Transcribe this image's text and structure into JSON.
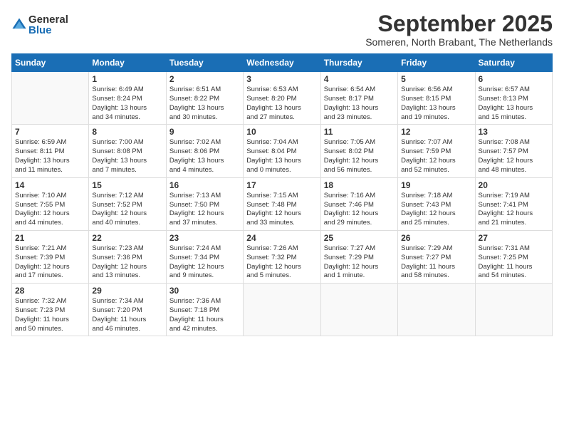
{
  "logo": {
    "general": "General",
    "blue": "Blue"
  },
  "title": "September 2025",
  "location": "Someren, North Brabant, The Netherlands",
  "weekdays": [
    "Sunday",
    "Monday",
    "Tuesday",
    "Wednesday",
    "Thursday",
    "Friday",
    "Saturday"
  ],
  "weeks": [
    [
      {
        "day": "",
        "content": ""
      },
      {
        "day": "1",
        "content": "Sunrise: 6:49 AM\nSunset: 8:24 PM\nDaylight: 13 hours\nand 34 minutes."
      },
      {
        "day": "2",
        "content": "Sunrise: 6:51 AM\nSunset: 8:22 PM\nDaylight: 13 hours\nand 30 minutes."
      },
      {
        "day": "3",
        "content": "Sunrise: 6:53 AM\nSunset: 8:20 PM\nDaylight: 13 hours\nand 27 minutes."
      },
      {
        "day": "4",
        "content": "Sunrise: 6:54 AM\nSunset: 8:17 PM\nDaylight: 13 hours\nand 23 minutes."
      },
      {
        "day": "5",
        "content": "Sunrise: 6:56 AM\nSunset: 8:15 PM\nDaylight: 13 hours\nand 19 minutes."
      },
      {
        "day": "6",
        "content": "Sunrise: 6:57 AM\nSunset: 8:13 PM\nDaylight: 13 hours\nand 15 minutes."
      }
    ],
    [
      {
        "day": "7",
        "content": "Sunrise: 6:59 AM\nSunset: 8:11 PM\nDaylight: 13 hours\nand 11 minutes."
      },
      {
        "day": "8",
        "content": "Sunrise: 7:00 AM\nSunset: 8:08 PM\nDaylight: 13 hours\nand 7 minutes."
      },
      {
        "day": "9",
        "content": "Sunrise: 7:02 AM\nSunset: 8:06 PM\nDaylight: 13 hours\nand 4 minutes."
      },
      {
        "day": "10",
        "content": "Sunrise: 7:04 AM\nSunset: 8:04 PM\nDaylight: 13 hours\nand 0 minutes."
      },
      {
        "day": "11",
        "content": "Sunrise: 7:05 AM\nSunset: 8:02 PM\nDaylight: 12 hours\nand 56 minutes."
      },
      {
        "day": "12",
        "content": "Sunrise: 7:07 AM\nSunset: 7:59 PM\nDaylight: 12 hours\nand 52 minutes."
      },
      {
        "day": "13",
        "content": "Sunrise: 7:08 AM\nSunset: 7:57 PM\nDaylight: 12 hours\nand 48 minutes."
      }
    ],
    [
      {
        "day": "14",
        "content": "Sunrise: 7:10 AM\nSunset: 7:55 PM\nDaylight: 12 hours\nand 44 minutes."
      },
      {
        "day": "15",
        "content": "Sunrise: 7:12 AM\nSunset: 7:52 PM\nDaylight: 12 hours\nand 40 minutes."
      },
      {
        "day": "16",
        "content": "Sunrise: 7:13 AM\nSunset: 7:50 PM\nDaylight: 12 hours\nand 37 minutes."
      },
      {
        "day": "17",
        "content": "Sunrise: 7:15 AM\nSunset: 7:48 PM\nDaylight: 12 hours\nand 33 minutes."
      },
      {
        "day": "18",
        "content": "Sunrise: 7:16 AM\nSunset: 7:46 PM\nDaylight: 12 hours\nand 29 minutes."
      },
      {
        "day": "19",
        "content": "Sunrise: 7:18 AM\nSunset: 7:43 PM\nDaylight: 12 hours\nand 25 minutes."
      },
      {
        "day": "20",
        "content": "Sunrise: 7:19 AM\nSunset: 7:41 PM\nDaylight: 12 hours\nand 21 minutes."
      }
    ],
    [
      {
        "day": "21",
        "content": "Sunrise: 7:21 AM\nSunset: 7:39 PM\nDaylight: 12 hours\nand 17 minutes."
      },
      {
        "day": "22",
        "content": "Sunrise: 7:23 AM\nSunset: 7:36 PM\nDaylight: 12 hours\nand 13 minutes."
      },
      {
        "day": "23",
        "content": "Sunrise: 7:24 AM\nSunset: 7:34 PM\nDaylight: 12 hours\nand 9 minutes."
      },
      {
        "day": "24",
        "content": "Sunrise: 7:26 AM\nSunset: 7:32 PM\nDaylight: 12 hours\nand 5 minutes."
      },
      {
        "day": "25",
        "content": "Sunrise: 7:27 AM\nSunset: 7:29 PM\nDaylight: 12 hours\nand 1 minute."
      },
      {
        "day": "26",
        "content": "Sunrise: 7:29 AM\nSunset: 7:27 PM\nDaylight: 11 hours\nand 58 minutes."
      },
      {
        "day": "27",
        "content": "Sunrise: 7:31 AM\nSunset: 7:25 PM\nDaylight: 11 hours\nand 54 minutes."
      }
    ],
    [
      {
        "day": "28",
        "content": "Sunrise: 7:32 AM\nSunset: 7:23 PM\nDaylight: 11 hours\nand 50 minutes."
      },
      {
        "day": "29",
        "content": "Sunrise: 7:34 AM\nSunset: 7:20 PM\nDaylight: 11 hours\nand 46 minutes."
      },
      {
        "day": "30",
        "content": "Sunrise: 7:36 AM\nSunset: 7:18 PM\nDaylight: 11 hours\nand 42 minutes."
      },
      {
        "day": "",
        "content": ""
      },
      {
        "day": "",
        "content": ""
      },
      {
        "day": "",
        "content": ""
      },
      {
        "day": "",
        "content": ""
      }
    ]
  ]
}
